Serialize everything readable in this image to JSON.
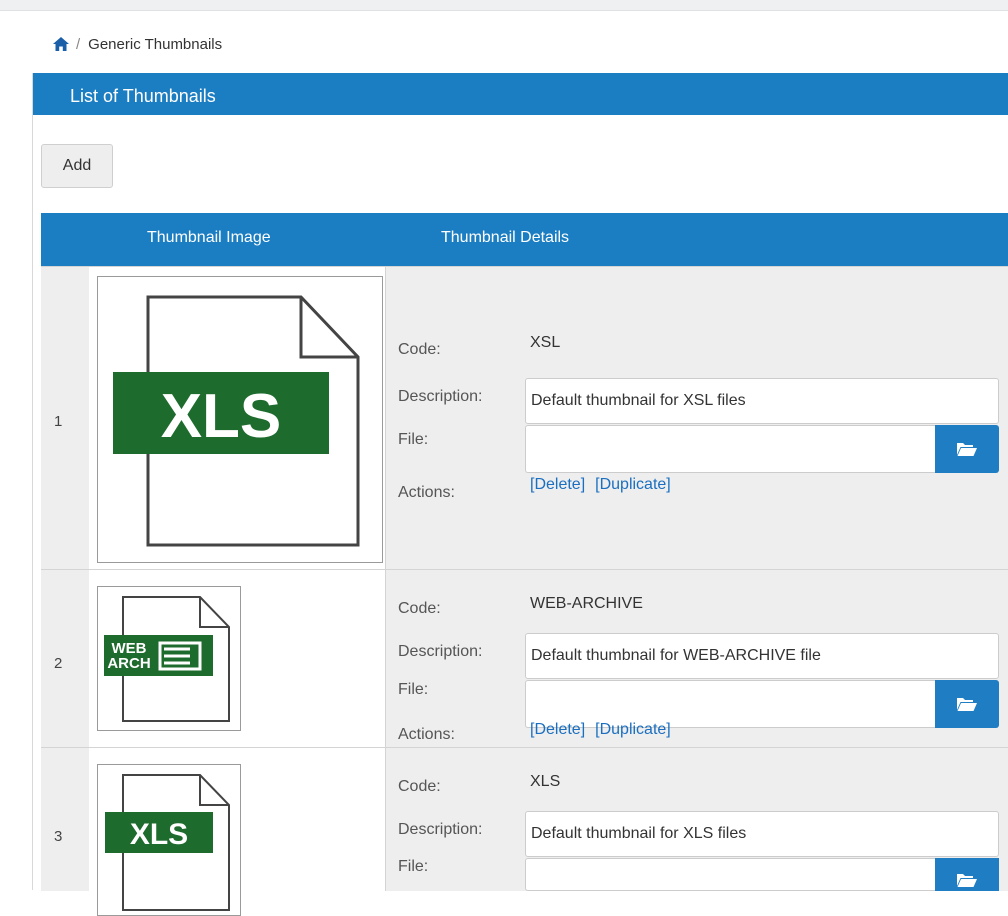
{
  "breadcrumb": {
    "home_icon": "home-icon",
    "separator": "/",
    "current": "Generic Thumbnails"
  },
  "panel": {
    "title": "List of Thumbnails"
  },
  "toolbar": {
    "add_label": "Add"
  },
  "table": {
    "headers": {
      "image": "Thumbnail Image",
      "details": "Thumbnail Details"
    },
    "labels": {
      "code": "Code:",
      "description": "Description:",
      "file": "File:",
      "actions": "Actions:"
    },
    "actions": {
      "delete": "[Delete]",
      "duplicate": "[Duplicate]"
    },
    "browse_icon": "folder-open-icon",
    "rows": [
      {
        "number": "1",
        "code": "XSL",
        "description": "Default thumbnail for XSL files",
        "file": "",
        "thumbnail_text": "XLS"
      },
      {
        "number": "2",
        "code": "WEB-ARCHIVE",
        "description": "Default thumbnail for WEB-ARCHIVE file",
        "file": "",
        "thumbnail_text": [
          "WEB",
          "ARCH"
        ]
      },
      {
        "number": "3",
        "code": "XLS",
        "description": "Default thumbnail for XLS files",
        "file": "",
        "thumbnail_text": "XLS"
      }
    ]
  },
  "colors": {
    "header_blue": "#1b7ec2",
    "link_blue": "#1b6fc0",
    "row_bg": "#eeeeee",
    "thumb_green": "#1e6b2e"
  }
}
